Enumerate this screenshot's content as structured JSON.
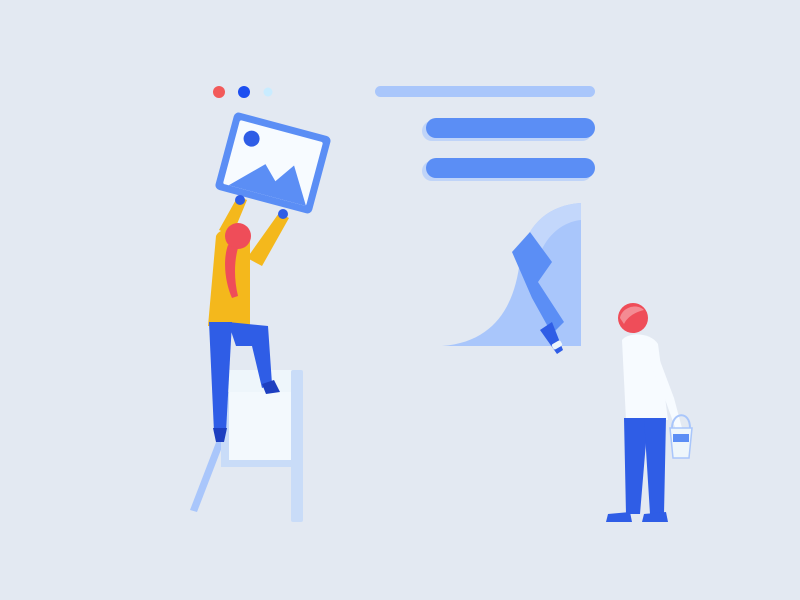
{
  "illustration": {
    "background_color": "#e3e9f2",
    "window_dots": [
      "#f25a5a",
      "#1d4ff0",
      "#c9ecff"
    ],
    "accent_blue": "#5b8ef5",
    "light_blue": "#a9c6fb",
    "ladder_color": "#eef6fb",
    "shirt_color": "#f4b81c",
    "hair_color": "#ef4d59",
    "pants_color": "#2f5de6",
    "shirt_white": "#f7fbff"
  }
}
